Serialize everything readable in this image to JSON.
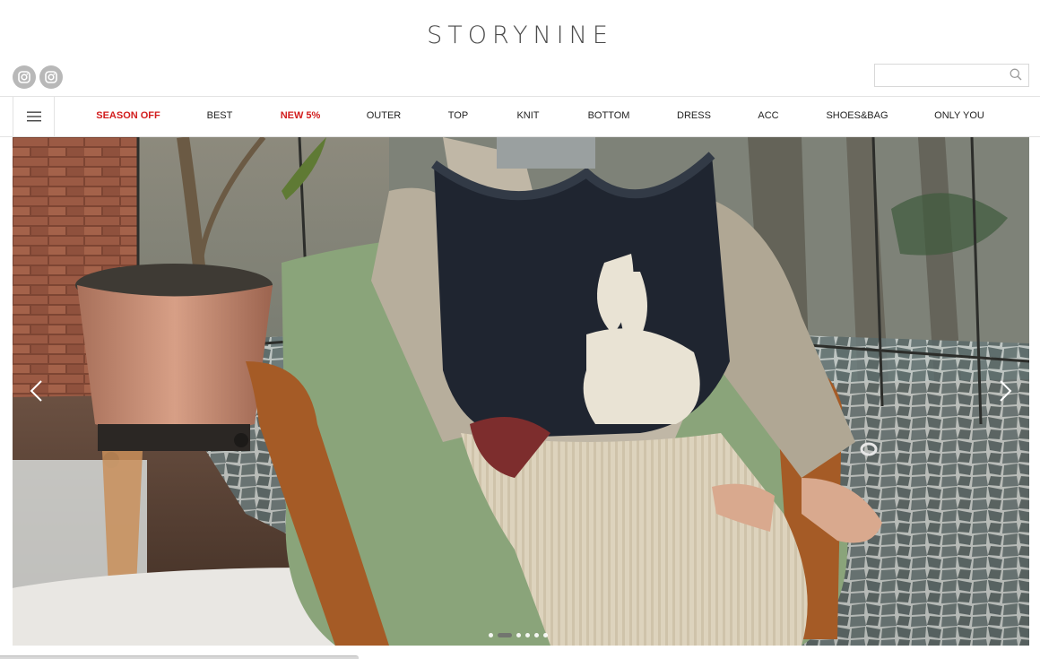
{
  "brand": {
    "logo": "STORYNINE"
  },
  "social": [
    {
      "icon": "instagram-icon"
    },
    {
      "icon": "instagram-icon"
    }
  ],
  "search": {
    "placeholder": "",
    "value": "",
    "icon": "search-icon"
  },
  "nav": {
    "menu_icon": "hamburger-icon",
    "items": [
      {
        "label": "SEASON OFF",
        "highlight": true
      },
      {
        "label": "BEST",
        "highlight": false
      },
      {
        "label": "NEW 5%",
        "highlight": true
      },
      {
        "label": "OUTER",
        "highlight": false
      },
      {
        "label": "TOP",
        "highlight": false
      },
      {
        "label": "KNIT",
        "highlight": false
      },
      {
        "label": "BOTTOM",
        "highlight": false
      },
      {
        "label": "DRESS",
        "highlight": false
      },
      {
        "label": "ACC",
        "highlight": false
      },
      {
        "label": "SHOES&BAG",
        "highlight": false
      },
      {
        "label": "ONLY YOU",
        "highlight": false
      }
    ]
  },
  "hero": {
    "prev_icon": "chevron-left-icon",
    "next_icon": "chevron-right-icon",
    "slide_count": 6,
    "active_slide": 2
  },
  "colors": {
    "highlight": "#d21d1d",
    "text": "#222222",
    "border": "#e3e3e3"
  }
}
